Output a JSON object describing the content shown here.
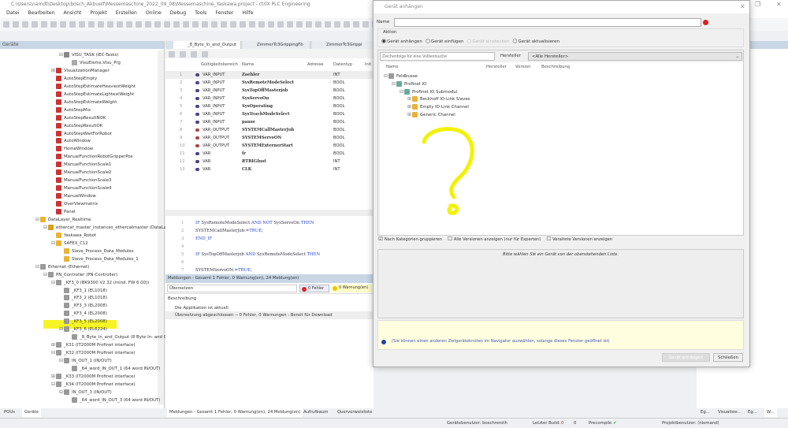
{
  "window": {
    "title": "C:\\Users\\namdt\\Desktop\\bosch_Akbuelf\\Messemaschine_2022_09_08\\Messemaschine_Yaskawa.project - ctrlX PLC Engineering"
  },
  "menu": [
    "Datei",
    "Bearbeiten",
    "Ansicht",
    "Projekt",
    "Erstellen",
    "Online",
    "Debug",
    "Tools",
    "Fenster",
    "Hilfe"
  ],
  "devices_panel": {
    "title": "Geräte",
    "tree": [
      {
        "label": "VISU_TASK (IEC-Tasks)",
        "level": 3,
        "exp": "-",
        "icon": "task"
      },
      {
        "label": "VisuElems.Visu_Prg",
        "level": 4,
        "icon": "prg"
      },
      {
        "label": "VisualizationManager",
        "level": 2,
        "exp": "+",
        "icon": "visu"
      },
      {
        "label": "AutoStepEmpty",
        "level": 2,
        "icon": "visu"
      },
      {
        "label": "AutoStepEstimateHeaviestWeight",
        "level": 2,
        "icon": "visu"
      },
      {
        "label": "AutoStepEstimateLightestWeight",
        "level": 2,
        "icon": "visu"
      },
      {
        "label": "AutoStepEstimateWeight",
        "level": 2,
        "icon": "visu"
      },
      {
        "label": "AutoStepMix",
        "level": 2,
        "icon": "visu"
      },
      {
        "label": "AutoStepResultNOK",
        "level": 2,
        "icon": "visu"
      },
      {
        "label": "AutoStepResultOK",
        "level": 2,
        "icon": "visu"
      },
      {
        "label": "AutoStepWaitForRobot",
        "level": 2,
        "icon": "visu"
      },
      {
        "label": "AutoWindow",
        "level": 2,
        "icon": "visu"
      },
      {
        "label": "HomeWindow",
        "level": 2,
        "icon": "visu"
      },
      {
        "label": "ManualFunctionRobotGripperPos",
        "level": 2,
        "icon": "visu"
      },
      {
        "label": "ManualFunctionScale1",
        "level": 2,
        "icon": "visu"
      },
      {
        "label": "ManualFunctionScale2",
        "level": 2,
        "icon": "visu"
      },
      {
        "label": "ManualFunctionScale3",
        "level": 2,
        "icon": "visu"
      },
      {
        "label": "ManualFunctionScale4",
        "level": 2,
        "icon": "visu"
      },
      {
        "label": "ManualWindow",
        "level": 2,
        "icon": "visu"
      },
      {
        "label": "OverViewmatrix",
        "level": 2,
        "icon": "visu"
      },
      {
        "label": "Panel",
        "level": 2,
        "icon": "visu"
      },
      {
        "label": "DataLayer_Realtime",
        "level": 0,
        "exp": "-",
        "icon": "folder"
      },
      {
        "label": "ethercat_master_instances_ethercatmaster (DataLayerUs",
        "level": 1,
        "exp": "-",
        "icon": "dl"
      },
      {
        "label": "Yaskawa_Robot",
        "level": 2,
        "icon": "folder"
      },
      {
        "label": "SAFEX_C12",
        "level": 2,
        "exp": "-",
        "icon": "folder"
      },
      {
        "label": "Slave_Process_Data_Modules",
        "level": 3,
        "icon": "folder"
      },
      {
        "label": "Slave_Process_Data_Modules_1",
        "level": 3,
        "icon": "folder"
      },
      {
        "label": "Ethernet (Ethernet)",
        "level": 0,
        "exp": "-",
        "icon": "dev"
      },
      {
        "label": "PN_Controller (PN-Controller)",
        "level": 1,
        "exp": "-",
        "icon": "dev"
      },
      {
        "label": "_KF3_0 (BK9300 V2.32 (mind. FW 6.00))",
        "level": 2,
        "exp": "-",
        "icon": "dev"
      },
      {
        "label": "_KF3_1 (EL1018)",
        "level": 3,
        "icon": "dev"
      },
      {
        "label": "_KF3_2 (EL1018)",
        "level": 3,
        "icon": "dev"
      },
      {
        "label": "_KF3_3 (EL2008)",
        "level": 3,
        "icon": "dev"
      },
      {
        "label": "_KF3_4 (EL2008)",
        "level": 3,
        "icon": "dev"
      },
      {
        "label": "_KF3_5 (EL2008)",
        "level": 3,
        "icon": "dev"
      },
      {
        "label": "_KF3_6 (EL6224)",
        "level": 3,
        "exp": "-",
        "icon": "dev"
      },
      {
        "label": "_8_Byte_In_and_Output (8 Byte In- and Outp",
        "level": 4,
        "icon": "dev"
      },
      {
        "label": "_K31 (IT2000M Profinet interface)",
        "level": 2,
        "exp": "+",
        "icon": "dev"
      },
      {
        "label": "_K32 (IT2000M Profinet interface)",
        "level": 2,
        "exp": "-",
        "icon": "dev"
      },
      {
        "label": "IN_OUT_1 (IN/OUT)",
        "level": 3,
        "exp": "-",
        "icon": "dev"
      },
      {
        "label": "_64_word_IN_OUT_1 (64 word IN/OUT)",
        "level": 4,
        "icon": "dev"
      },
      {
        "label": "_K33 (IT2000M Profinet interface)",
        "level": 2,
        "exp": "+",
        "icon": "dev"
      },
      {
        "label": "_K34 (IT2000M Profinet interface)",
        "level": 2,
        "exp": "-",
        "icon": "dev"
      },
      {
        "label": "IN_OUT_3 (IN/OUT)",
        "level": 3,
        "exp": "-",
        "icon": "dev"
      },
      {
        "label": "_64_word_IN_OUT_3 (64 word IN/OUT)",
        "level": 4,
        "icon": "dev"
      }
    ],
    "bottom_tabs": [
      "POUs",
      "Geräte"
    ]
  },
  "editor": {
    "tabs": [
      "_8_Byte_In_and_Output",
      "ZimmerTc3GrippingFb",
      "ZimmerTc3Grippi"
    ],
    "columns": [
      "Gültigkeitsbereich",
      "Name",
      "Adresse",
      "Datentyp",
      "Init"
    ],
    "rows": [
      [
        "1",
        "VAR_INPUT",
        "Zaehler",
        "INT"
      ],
      [
        "2",
        "VAR_INPUT",
        "SysRemoteModeSelect",
        "BOOL"
      ],
      [
        "3",
        "VAR_INPUT",
        "SysTopOffMasterjob",
        "BOOL"
      ],
      [
        "4",
        "VAR_INPUT",
        "SysServoOn",
        "BOOL"
      ],
      [
        "5",
        "VAR_INPUT",
        "SysOperating",
        "BOOL"
      ],
      [
        "6",
        "VAR_INPUT",
        "SysTeachModeSelect",
        "BOOL"
      ],
      [
        "7",
        "VAR_INPUT",
        "pause",
        "BOOL"
      ],
      [
        "8",
        "VAR_OUTPUT",
        "SYSTEMCallMasterJob",
        "BOOL"
      ],
      [
        "9",
        "VAR_OUTPUT",
        "SYSTEMServoON",
        "BOOL"
      ],
      [
        "10",
        "VAR_OUTPUT",
        "SYSTEMExternerStart",
        "BOOL"
      ],
      [
        "11",
        "VAR",
        "fr",
        "BOOL"
      ],
      [
        "12",
        "VAR",
        "RTRIGInst",
        "INT"
      ],
      [
        "13",
        "VAR",
        "CLK",
        "INT"
      ]
    ],
    "code": [
      [
        "1",
        [
          [
            "IF ",
            "kw"
          ],
          [
            "SysRemoteModeSelect ",
            ""
          ],
          [
            "AND NOT ",
            "kw"
          ],
          [
            "SysServoOn ",
            ""
          ],
          [
            "THEN",
            "kw"
          ]
        ]
      ],
      [
        "2",
        [
          [
            "SYSTEMCallMasterJob:=",
            ""
          ],
          [
            "TRUE",
            "kw"
          ],
          [
            ";",
            ""
          ]
        ]
      ],
      [
        "3",
        [
          [
            "END_IF",
            "kw"
          ]
        ]
      ],
      [
        "4",
        []
      ],
      [
        "5",
        [
          [
            "IF ",
            "kw"
          ],
          [
            "SysTopOffMasterjob ",
            ""
          ],
          [
            "AND ",
            "kw"
          ],
          [
            "SysRemoteModeSelect ",
            ""
          ],
          [
            "THEN",
            "kw"
          ]
        ]
      ],
      [
        "6",
        []
      ],
      [
        "7",
        [
          [
            "SYSTEMServoON:=",
            ""
          ],
          [
            "TRUE",
            "kw"
          ],
          [
            ";",
            ""
          ]
        ]
      ]
    ]
  },
  "messages": {
    "header": "Meldungen - Gesamt 1 Fehler, 0 Warnung(en), 24 Meldung(en)",
    "filter": "Übersetzen",
    "errors": "0 Fehler",
    "warnings": "0 Warnung(en)",
    "col": "Beschreibung",
    "lines": [
      "Die Applikation ist aktuell",
      "Übersetzung abgeschlossen -- 0 Fehler, 0 Warnungen : Bereit für Download"
    ]
  },
  "bottom_tabs": [
    "Meldungen - Gesamt 1 Fehler, 0 Warnung(en), 24 Meldung(en)",
    "Aufrufbaum",
    "Querverweisliste"
  ],
  "right_tabs": [
    "Eg...",
    "Visualisie...",
    "Eg...",
    "W..."
  ],
  "dialog": {
    "title": "Gerät anhängen",
    "name_label": "Name",
    "name_value": "",
    "action_label": "Aktion",
    "radios": [
      {
        "label": "Gerät anhängen",
        "checked": true,
        "enabled": true
      },
      {
        "label": "Gerät einfügen",
        "checked": false,
        "enabled": true
      },
      {
        "label": "Gerät einstecken",
        "checked": false,
        "enabled": false
      },
      {
        "label": "Gerät aktualisieren",
        "checked": false,
        "enabled": true
      }
    ],
    "search_placeholder": "Zeichenfolge für eine Volltextsuche",
    "vendor_label": "Hersteller",
    "vendor_value": "<Alle Hersteller>",
    "columns": [
      "Name",
      "Hersteller",
      "Version",
      "Beschreibung"
    ],
    "tree": [
      {
        "label": "Feldbusse",
        "level": 0,
        "exp": "-",
        "icon": "dev"
      },
      {
        "label": "Profinet IO",
        "level": 1,
        "exp": "-",
        "icon": "net"
      },
      {
        "label": "Profinet IO Submodul",
        "level": 2,
        "exp": "-",
        "icon": "net"
      },
      {
        "label": "Beckhoff IO-Link Slaves",
        "level": 3,
        "exp": "+",
        "icon": "folder"
      },
      {
        "label": "Empty IO-Link Channel",
        "level": 3,
        "exp": "+",
        "icon": "folder"
      },
      {
        "label": "Generic Channel",
        "level": 3,
        "exp": "+",
        "icon": "folder"
      }
    ],
    "checkboxes": [
      {
        "label": "Nach Kategorien gruppieren",
        "checked": true
      },
      {
        "label": "Alle Versionen anzeigen (nur für Experten)",
        "checked": false
      },
      {
        "label": "Veraltete Versionen anzeigen",
        "checked": false
      }
    ],
    "info_text": "Bitte wählen Sie ein Gerät von der obenstehenden Liste.",
    "hint": "(Sie können einen anderen Zielgeräteknoten im Navigator auswählen, solange dieses Fenster geöffnet ist)",
    "attach_button": "Gerät anhängen",
    "close_button": "Schließen"
  },
  "status": {
    "device_user": "Gerätebenutzer: boschreroth",
    "last_build": "Letzter Build:",
    "errors": "0",
    "warnings": "0",
    "precompile": "Precompile",
    "project_user": "Projektbenutzer: (niemand)"
  },
  "colors": {
    "highlight": "#f6f200",
    "annotation": "#f2f200",
    "panel_header": "#c8d6e5"
  }
}
